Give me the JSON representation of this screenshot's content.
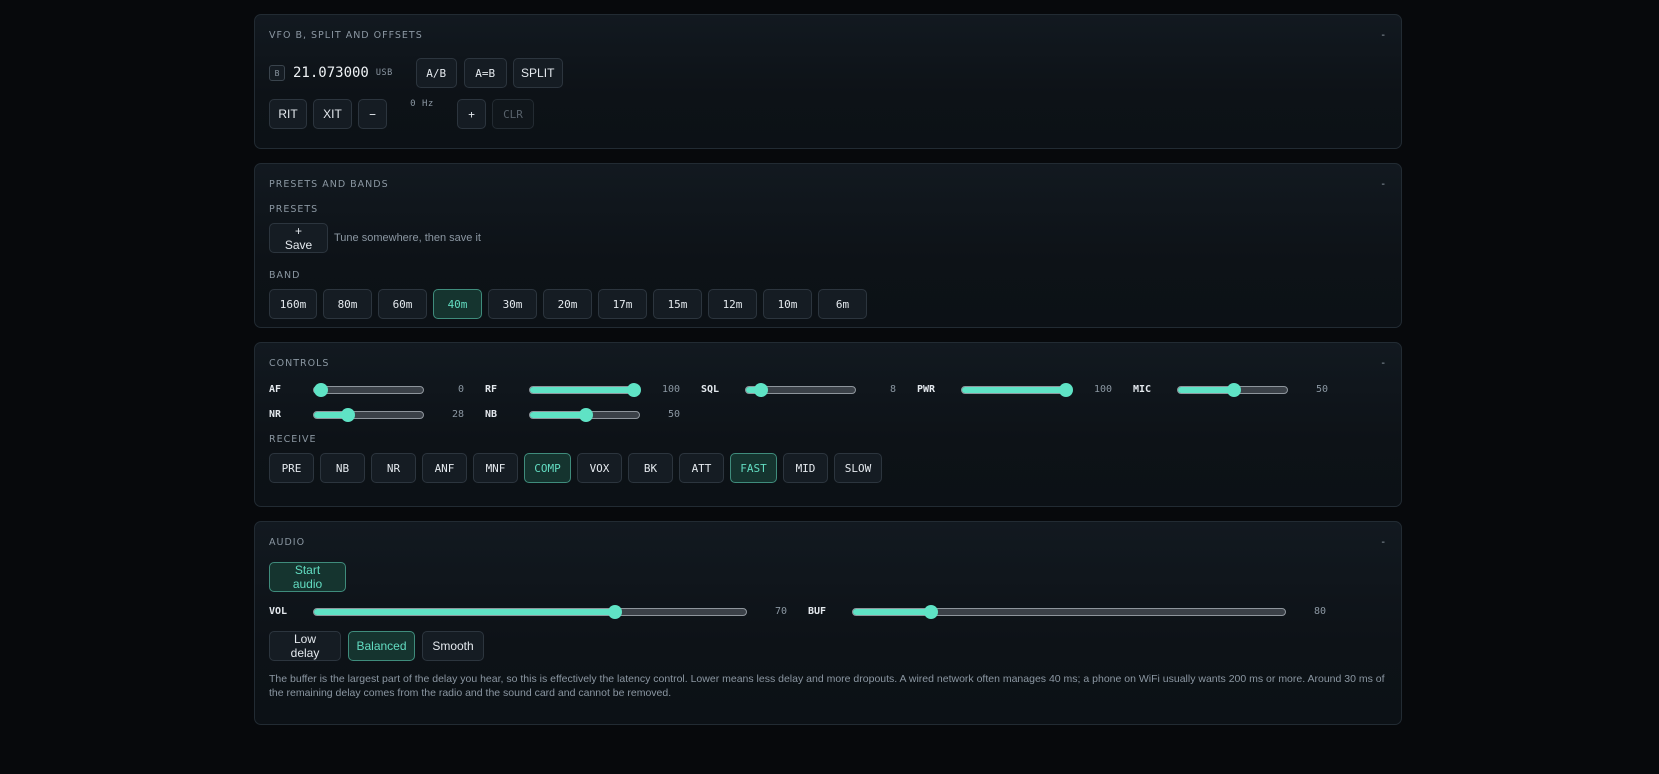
{
  "vfo": {
    "title": "VFO B, SPLIT AND OFFSETS",
    "collapse_label": "-",
    "badge": "B",
    "frequency": "21.073000",
    "mode": "USB",
    "buttons": [
      "A/B",
      "A=B",
      "SPLIT"
    ],
    "rit_label": "RIT",
    "xit_label": "XIT",
    "minus_label": "−",
    "offset": "0 Hz",
    "plus_label": "+",
    "clear_label": "CLR"
  },
  "presets": {
    "title": "PRESETS AND BANDS",
    "collapse_label": "-",
    "presets_label": "PRESETS",
    "save_label": "+ Save",
    "save_hint": "Tune somewhere, then save it",
    "band_label": "BAND",
    "bands": [
      {
        "label": "160m",
        "active": false
      },
      {
        "label": "80m",
        "active": false
      },
      {
        "label": "60m",
        "active": false
      },
      {
        "label": "40m",
        "active": true
      },
      {
        "label": "30m",
        "active": false
      },
      {
        "label": "20m",
        "active": false
      },
      {
        "label": "17m",
        "active": false
      },
      {
        "label": "15m",
        "active": false
      },
      {
        "label": "12m",
        "active": false
      },
      {
        "label": "10m",
        "active": false
      },
      {
        "label": "6m",
        "active": false
      }
    ]
  },
  "controls": {
    "title": "CONTROLS",
    "collapse_label": "-",
    "sliders_row1": [
      {
        "label": "AF",
        "value": 0,
        "display": "0"
      },
      {
        "label": "RF",
        "value": 100,
        "display": "100"
      },
      {
        "label": "SQL",
        "value": 8,
        "display": "8"
      },
      {
        "label": "PWR",
        "value": 100,
        "display": "100"
      },
      {
        "label": "MIC",
        "value": 50,
        "display": "50"
      }
    ],
    "sliders_row2": [
      {
        "label": "NR",
        "value": 28,
        "display": "28"
      },
      {
        "label": "NB",
        "value": 50,
        "display": "50"
      }
    ],
    "receive_label": "RECEIVE",
    "receive": [
      {
        "label": "PRE",
        "active": false
      },
      {
        "label": "NB",
        "active": false
      },
      {
        "label": "NR",
        "active": false
      },
      {
        "label": "ANF",
        "active": false
      },
      {
        "label": "MNF",
        "active": false
      },
      {
        "label": "COMP",
        "active": true
      },
      {
        "label": "VOX",
        "active": false
      },
      {
        "label": "BK",
        "active": false
      },
      {
        "label": "ATT",
        "active": false
      },
      {
        "label": "FAST",
        "active": true
      },
      {
        "label": "MID",
        "active": false
      },
      {
        "label": "SLOW",
        "active": false
      }
    ]
  },
  "audio": {
    "title": "AUDIO",
    "collapse_label": "-",
    "start_label": "Start audio",
    "vol": {
      "label": "VOL",
      "value": 70,
      "display": "70"
    },
    "buf": {
      "label": "BUF",
      "value": 17,
      "display": "80"
    },
    "modes": [
      {
        "label": "Low delay",
        "active": false
      },
      {
        "label": "Balanced",
        "active": true
      },
      {
        "label": "Smooth",
        "active": false
      }
    ],
    "description": "The buffer is the largest part of the delay you hear, so this is effectively the latency control. Lower means less delay and more dropouts. A wired network often manages 40 ms; a phone on WiFi usually wants 200 ms or more. Around 30 ms of the remaining delay comes from the radio and the sound card and cannot be removed."
  },
  "colors": {
    "accent": "#5fe3c5",
    "active_bg": "#15342f",
    "panel_border": "#222b33",
    "background": "#07090c"
  }
}
